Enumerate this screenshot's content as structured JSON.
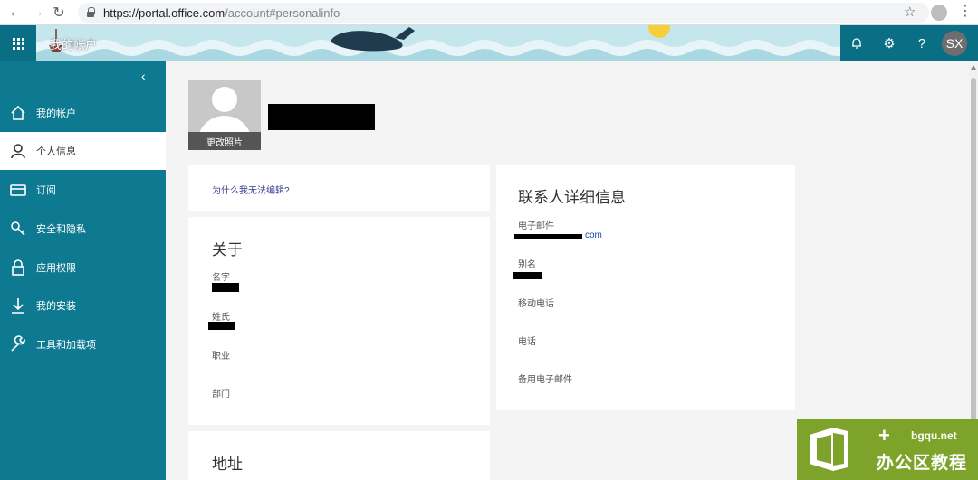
{
  "browser": {
    "url_host": "https://portal.office.com",
    "url_path": "/account#personalinfo",
    "back_glyph": "←",
    "forward_glyph": "→",
    "reload_glyph": "↻",
    "star_glyph": "☆",
    "menu_glyph": "⋮"
  },
  "header": {
    "app_title": "我的帐户",
    "settings_glyph": "⚙",
    "help_glyph": "?",
    "avatar_initials": "SX",
    "accent_color": "#0f7d94"
  },
  "sidebar": {
    "collapse_glyph": "‹",
    "items": [
      {
        "label": "我的帐户",
        "icon": "home-icon"
      },
      {
        "label": "个人信息",
        "icon": "person-icon",
        "active": true
      },
      {
        "label": "订阅",
        "icon": "card-icon"
      },
      {
        "label": "安全和隐私",
        "icon": "key-icon"
      },
      {
        "label": "应用权限",
        "icon": "lock-icon"
      },
      {
        "label": "我的安装",
        "icon": "download-icon"
      },
      {
        "label": "工具和加载项",
        "icon": "wrench-icon"
      }
    ]
  },
  "profile": {
    "change_photo_label": "更改照片"
  },
  "why_card": {
    "link_text": "为什么我无法编辑?"
  },
  "about": {
    "title": "关于",
    "first_name_label": "名字",
    "last_name_label": "姓氏",
    "job_label": "职业",
    "department_label": "部门"
  },
  "address": {
    "title": "地址"
  },
  "contact": {
    "title": "联系人详细信息",
    "email_label": "电子邮件",
    "email_suffix": "com",
    "alias_label": "别名",
    "mobile_label": "移动电话",
    "phone_label": "电话",
    "alt_email_label": "备用电子邮件"
  },
  "watermark": {
    "site": "bgqu.net",
    "name": "办公区教程",
    "color": "#7ea32a"
  }
}
